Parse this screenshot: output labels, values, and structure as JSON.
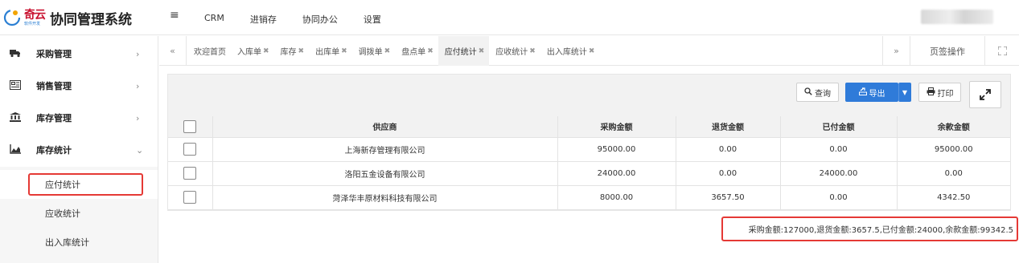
{
  "app": {
    "logo_brand": "奇云",
    "logo_tagline": "软件开发",
    "title": "协同管理系统"
  },
  "topnav": [
    "CRM",
    "进销存",
    "协同办公",
    "设置"
  ],
  "sidebar": {
    "items": [
      {
        "label": "采购管理",
        "icon": "truck-icon",
        "arrow": "›"
      },
      {
        "label": "销售管理",
        "icon": "register-icon",
        "arrow": "›"
      },
      {
        "label": "库存管理",
        "icon": "bank-icon",
        "arrow": "›"
      },
      {
        "label": "库存统计",
        "icon": "area-chart-icon",
        "arrow": "⌄"
      }
    ],
    "subitems": [
      {
        "label": "应付统计",
        "active": true
      },
      {
        "label": "应收统计",
        "active": false
      },
      {
        "label": "出入库统计",
        "active": false
      }
    ]
  },
  "tabs": {
    "items": [
      {
        "label": "欢迎首页",
        "closable": false
      },
      {
        "label": "入库单",
        "closable": true
      },
      {
        "label": "库存",
        "closable": true
      },
      {
        "label": "出库单",
        "closable": true
      },
      {
        "label": "调拨单",
        "closable": true
      },
      {
        "label": "盘点单",
        "closable": true
      },
      {
        "label": "应付统计",
        "closable": true,
        "active": true
      },
      {
        "label": "应收统计",
        "closable": true
      },
      {
        "label": "出入库统计",
        "closable": true
      }
    ],
    "page_ops_label": "页签操作"
  },
  "toolbar": {
    "query_label": "查询",
    "export_label": "导出",
    "print_label": "打印"
  },
  "table": {
    "headers": [
      "供应商",
      "采购金额",
      "退货金额",
      "已付金额",
      "余款金额"
    ],
    "rows": [
      [
        "上海新存管理有限公司",
        "95000.00",
        "0.00",
        "0.00",
        "95000.00"
      ],
      [
        "洛阳五金设备有限公司",
        "24000.00",
        "0.00",
        "24000.00",
        "0.00"
      ],
      [
        "菏泽华丰原材料科技有限公司",
        "8000.00",
        "3657.50",
        "0.00",
        "4342.50"
      ]
    ]
  },
  "summary": "采购金额:127000,退货金额:3657.5,已付金额:24000,余款金额:99342.5",
  "colors": {
    "accent": "#2f7bd9",
    "highlight": "#e53935",
    "brand_red": "#c8102e"
  }
}
